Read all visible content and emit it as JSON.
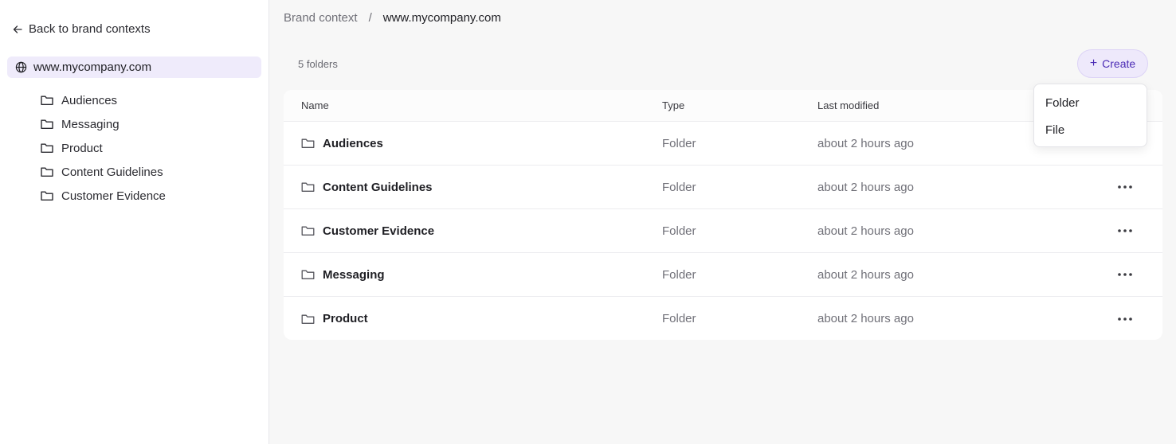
{
  "sidebar": {
    "back_label": "Back to brand contexts",
    "root_label": "www.mycompany.com",
    "items": [
      {
        "label": "Audiences"
      },
      {
        "label": "Messaging"
      },
      {
        "label": "Product"
      },
      {
        "label": "Content Guidelines"
      },
      {
        "label": "Customer Evidence"
      }
    ]
  },
  "breadcrumb": {
    "parent": "Brand context",
    "separator": "/",
    "current": "www.mycompany.com"
  },
  "toolbar": {
    "count": "5 folders",
    "create_icon": "+",
    "create_label": "Create"
  },
  "table": {
    "headers": {
      "name": "Name",
      "type": "Type",
      "modified": "Last modified"
    },
    "rows": [
      {
        "name": "Audiences",
        "type": "Folder",
        "modified": "about 2 hours ago"
      },
      {
        "name": "Content Guidelines",
        "type": "Folder",
        "modified": "about 2 hours ago"
      },
      {
        "name": "Customer Evidence",
        "type": "Folder",
        "modified": "about 2 hours ago"
      },
      {
        "name": "Messaging",
        "type": "Folder",
        "modified": "about 2 hours ago"
      },
      {
        "name": "Product",
        "type": "Folder",
        "modified": "about 2 hours ago"
      }
    ]
  },
  "dropdown": {
    "items": [
      {
        "label": "Folder"
      },
      {
        "label": "File"
      }
    ]
  },
  "colors": {
    "accent": "#4b2bb5",
    "accent_bg": "#eee9fb",
    "selected_bg": "#efebfb"
  }
}
